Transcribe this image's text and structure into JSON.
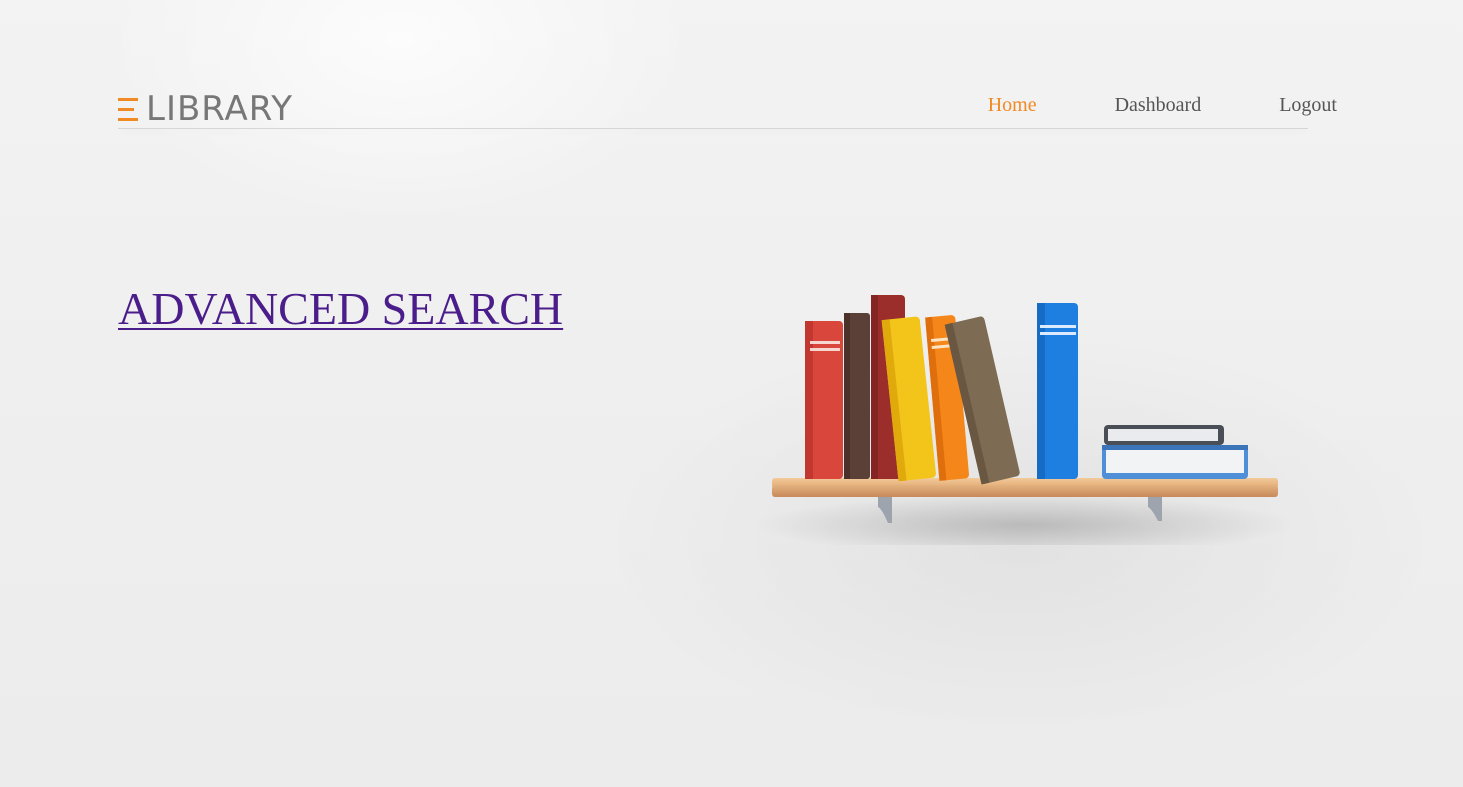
{
  "header": {
    "logo_text": "LIBRARY",
    "logo_icon": "e-bars-logo-icon",
    "accent_color": "#f08a24"
  },
  "nav": {
    "items": [
      {
        "label": "Home",
        "active": true
      },
      {
        "label": "Dashboard",
        "active": false
      },
      {
        "label": "Logout",
        "active": false
      }
    ]
  },
  "main": {
    "search_link": "ADVANCED SEARCH",
    "search_link_color": "#4b1d8a",
    "illustration": "books-on-shelf-illustration"
  }
}
